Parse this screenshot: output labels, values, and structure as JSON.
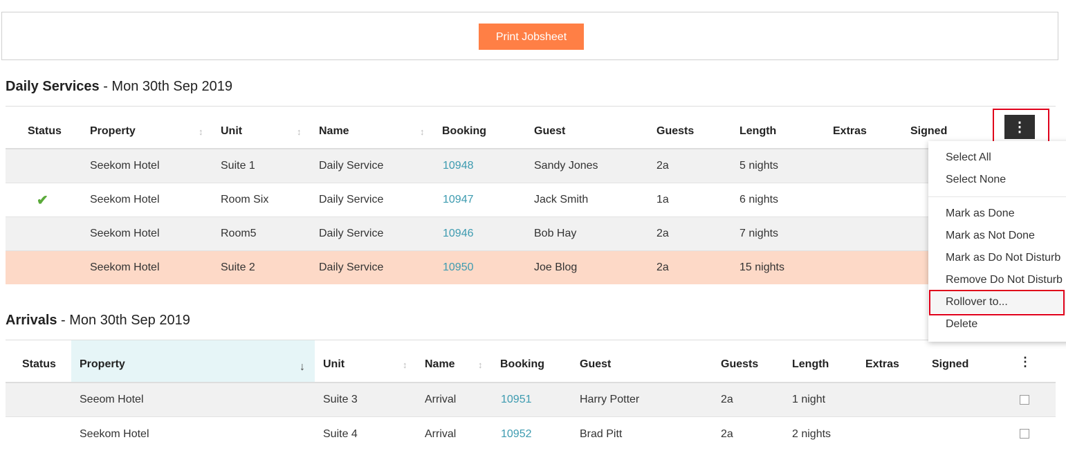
{
  "toolbar": {
    "print_label": "Print Jobsheet"
  },
  "daily": {
    "title_bold": "Daily Services",
    "title_rest": " - Mon 30th Sep 2019",
    "headers": [
      "Status",
      "Property",
      "Unit",
      "Name",
      "Booking",
      "Guest",
      "Guests",
      "Length",
      "Extras",
      "Signed"
    ],
    "rows": [
      {
        "status": "",
        "property": "Seekom Hotel",
        "unit": "Suite 1",
        "name": "Daily Service",
        "booking": "10948",
        "guest": "Sandy Jones",
        "guests": "2a",
        "length": "5 nights"
      },
      {
        "status": "done",
        "property": "Seekom Hotel",
        "unit": "Room Six",
        "name": "Daily Service",
        "booking": "10947",
        "guest": "Jack Smith",
        "guests": "1a",
        "length": "6 nights"
      },
      {
        "status": "",
        "property": "Seekom Hotel",
        "unit": "Room5",
        "name": "Daily Service",
        "booking": "10946",
        "guest": "Bob Hay",
        "guests": "2a",
        "length": "7 nights"
      },
      {
        "status": "",
        "property": "Seekom Hotel",
        "unit": "Suite 2",
        "name": "Daily Service",
        "booking": "10950",
        "guest": "Joe Blog",
        "guests": "2a",
        "length": "15 nights"
      }
    ]
  },
  "menu": {
    "items": [
      "Select All",
      "Select None",
      "Mark as Done",
      "Mark as Not Done",
      "Mark as Do Not Disturb",
      "Remove Do Not Disturb",
      "Rollover to...",
      "Delete"
    ]
  },
  "arrivals": {
    "title_bold": "Arrivals",
    "title_rest": " - Mon 30th Sep 2019",
    "headers": [
      "Status",
      "Property",
      "Unit",
      "Name",
      "Booking",
      "Guest",
      "Guests",
      "Length",
      "Extras",
      "Signed"
    ],
    "rows": [
      {
        "property": "Seeom Hotel",
        "unit": "Suite 3",
        "name": "Arrival",
        "booking": "10951",
        "guest": "Harry Potter",
        "guests": "2a",
        "length": "1 night"
      },
      {
        "property": "Seekom Hotel",
        "unit": "Suite 4",
        "name": "Arrival",
        "booking": "10952",
        "guest": "Brad Pitt",
        "guests": "2a",
        "length": "2 nights"
      }
    ]
  },
  "icons": {
    "sort": "sort-icon",
    "sort_desc": "sort-down-icon",
    "kebab": "kebab-menu-icon",
    "check": "check-icon"
  },
  "colors": {
    "accent": "#ff7f45",
    "link": "#3d9bb0",
    "highlight_row": "#fdd9c7",
    "done": "#5aaa3a",
    "outline": "#e0001a"
  }
}
